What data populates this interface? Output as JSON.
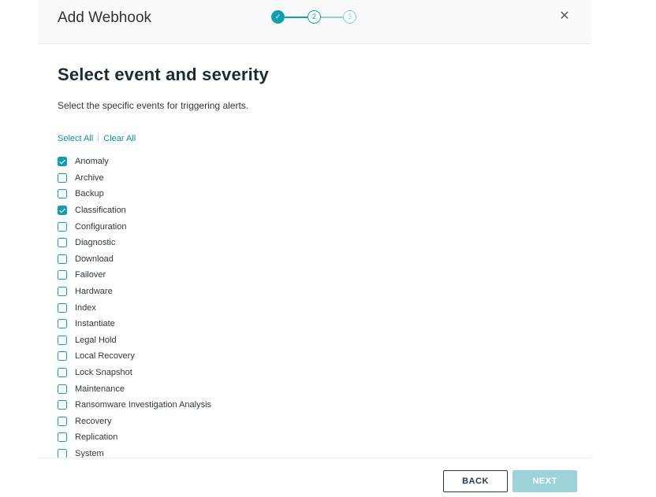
{
  "header": {
    "title": "Add Webhook",
    "steps": [
      {
        "state": "done",
        "label": "✓"
      },
      {
        "state": "current",
        "label": "2"
      },
      {
        "state": "upcoming",
        "label": "3"
      }
    ],
    "close_icon": "close-icon"
  },
  "main": {
    "heading": "Select event and severity",
    "subtitle": "Select the specific events for triggering alerts.",
    "select_all": "Select All",
    "clear_all": "Clear All",
    "events": [
      {
        "label": "Anomaly",
        "checked": true
      },
      {
        "label": "Archive",
        "checked": false
      },
      {
        "label": "Backup",
        "checked": false
      },
      {
        "label": "Classification",
        "checked": true
      },
      {
        "label": "Configuration",
        "checked": false
      },
      {
        "label": "Diagnostic",
        "checked": false
      },
      {
        "label": "Download",
        "checked": false
      },
      {
        "label": "Failover",
        "checked": false
      },
      {
        "label": "Hardware",
        "checked": false
      },
      {
        "label": "Index",
        "checked": false
      },
      {
        "label": "Instantiate",
        "checked": false
      },
      {
        "label": "Legal Hold",
        "checked": false
      },
      {
        "label": "Local Recovery",
        "checked": false
      },
      {
        "label": "Lock Snapshot",
        "checked": false
      },
      {
        "label": "Maintenance",
        "checked": false
      },
      {
        "label": "Ransomware Investigation Analysis",
        "checked": false
      },
      {
        "label": "Recovery",
        "checked": false
      },
      {
        "label": "Replication",
        "checked": false
      },
      {
        "label": "System",
        "checked": false
      }
    ]
  },
  "footer": {
    "back_label": "BACK",
    "next_label": "NEXT"
  },
  "colors": {
    "accent": "#0f9fb1",
    "next_disabled": "#9cd3da",
    "back_border": "#1f3a4a"
  }
}
